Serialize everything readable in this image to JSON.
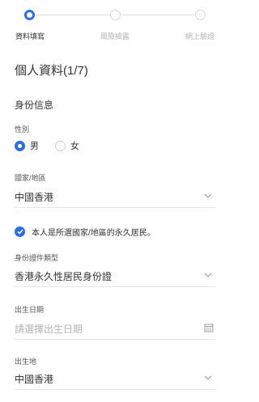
{
  "stepper": {
    "steps": [
      {
        "label": "資料填寫",
        "active": true
      },
      {
        "label": "風險披露",
        "active": false
      },
      {
        "label": "網上驗證",
        "active": false
      }
    ]
  },
  "form": {
    "title": "個人資料(1/7)",
    "section": "身份信息",
    "gender": {
      "label": "性別",
      "options": [
        {
          "label": "男",
          "checked": true
        },
        {
          "label": "女",
          "checked": false
        }
      ]
    },
    "country": {
      "label": "國家/地區",
      "value": "中國香港"
    },
    "resident_check": {
      "label": "本人是所選國家/地區的永久居民。",
      "checked": true
    },
    "id_type": {
      "label": "身份證件類型",
      "value": "香港永久性居民身份證"
    },
    "birthdate": {
      "label": "出生日期",
      "placeholder": "請選擇出生日期"
    },
    "birthplace": {
      "label": "出生地",
      "value": "中國香港"
    }
  },
  "colors": {
    "accent": "#2f6fdd"
  }
}
